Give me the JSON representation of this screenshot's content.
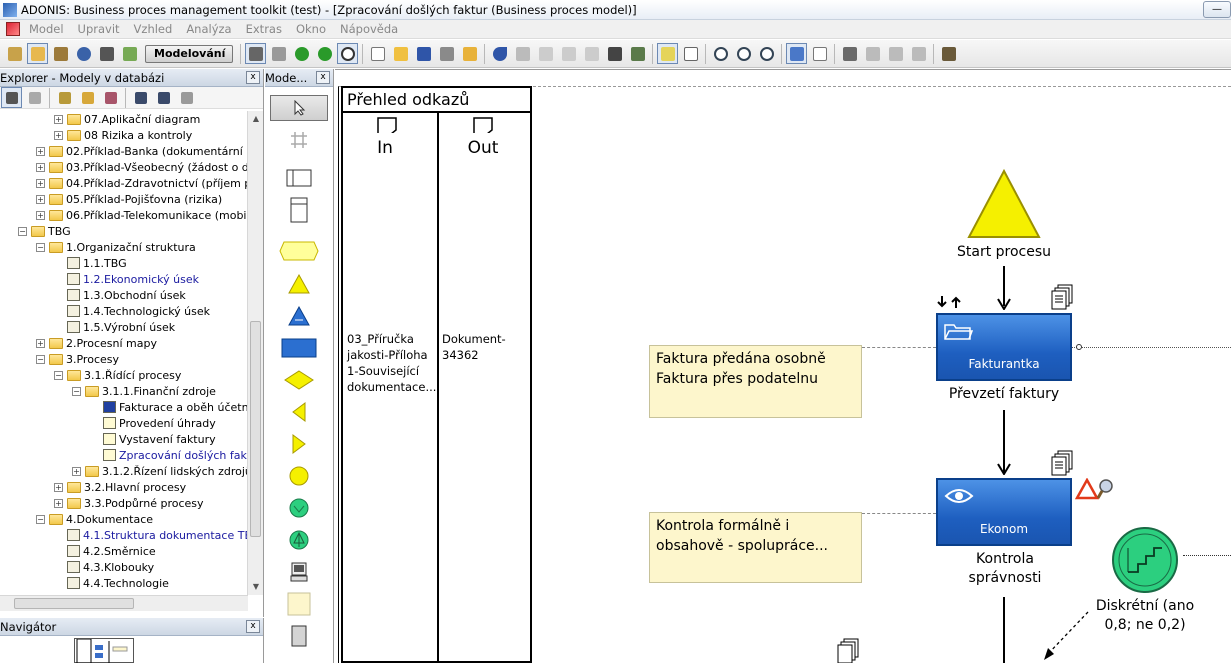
{
  "window": {
    "title": "ADONIS: Business proces management toolkit (test) - [Zpracování došlých faktur (Business proces model)]",
    "minimize_label": "—"
  },
  "menu": {
    "items": [
      "Model",
      "Upravit",
      "Vzhled",
      "Analýza",
      "Extras",
      "Okno",
      "Nápověda"
    ]
  },
  "toolbar": {
    "mode_label": "Modelování"
  },
  "explorer": {
    "title": "Explorer - Modely v databázi",
    "close_label": "x",
    "tree": [
      {
        "label": "07.Aplikační diagram",
        "level": 3,
        "type": "folder",
        "expander": "+"
      },
      {
        "label": "08 Rizika a kontroly",
        "level": 3,
        "type": "folder",
        "expander": "+"
      },
      {
        "label": "02.Příklad-Banka (dokumentární pla",
        "level": 2,
        "type": "folder",
        "expander": "+"
      },
      {
        "label": "03.Příklad-Všeobecný (žádost o dov",
        "level": 2,
        "type": "folder",
        "expander": "+"
      },
      {
        "label": "04.Příklad-Zdravotnictví (příjem pac",
        "level": 2,
        "type": "folder",
        "expander": "+"
      },
      {
        "label": "05.Příklad-Pojišťovna (rizika)",
        "level": 2,
        "type": "folder",
        "expander": "+"
      },
      {
        "label": "06.Příklad-Telekomunikace (mobilní",
        "level": 2,
        "type": "folder",
        "expander": "+"
      },
      {
        "label": "TBG",
        "level": 1,
        "type": "folder",
        "expander": "−"
      },
      {
        "label": "1.Organizační struktura",
        "level": 2,
        "type": "folder",
        "expander": "−"
      },
      {
        "label": "1.1.TBG",
        "level": 3,
        "type": "model"
      },
      {
        "label": "1.2.Ekonomický úsek",
        "level": 3,
        "type": "model",
        "highlight": true
      },
      {
        "label": "1.3.Obchodní úsek",
        "level": 3,
        "type": "model"
      },
      {
        "label": "1.4.Technologický úsek",
        "level": 3,
        "type": "model"
      },
      {
        "label": "1.5.Výrobní úsek",
        "level": 3,
        "type": "model"
      },
      {
        "label": "2.Procesní mapy",
        "level": 2,
        "type": "folder",
        "expander": "+"
      },
      {
        "label": "3.Procesy",
        "level": 2,
        "type": "folder",
        "expander": "−"
      },
      {
        "label": "3.1.Řídící procesy",
        "level": 3,
        "type": "folder",
        "expander": "−"
      },
      {
        "label": "3.1.1.Finanční zdroje",
        "level": 4,
        "type": "folder",
        "expander": "−"
      },
      {
        "label": "Fakturace a oběh účetn",
        "level": 5,
        "type": "model-blue"
      },
      {
        "label": "Provedení úhrady",
        "level": 5,
        "type": "proc"
      },
      {
        "label": "Vystavení faktury",
        "level": 5,
        "type": "proc"
      },
      {
        "label": "Zpracování došlých fakt",
        "level": 5,
        "type": "proc",
        "highlight": true
      },
      {
        "label": "3.1.2.Řízení lidských zdrojů",
        "level": 4,
        "type": "folder",
        "expander": "+"
      },
      {
        "label": "3.2.Hlavní procesy",
        "level": 3,
        "type": "folder",
        "expander": "+"
      },
      {
        "label": "3.3.Podpůrné procesy",
        "level": 3,
        "type": "folder",
        "expander": "+"
      },
      {
        "label": "4.Dokumentace",
        "level": 2,
        "type": "folder",
        "expander": "−"
      },
      {
        "label": "4.1.Struktura dokumentace TBG",
        "level": 3,
        "type": "model",
        "highlight": true
      },
      {
        "label": "4.2.Směrnice",
        "level": 3,
        "type": "model"
      },
      {
        "label": "4.3.Klobouky",
        "level": 3,
        "type": "model"
      },
      {
        "label": "4.4.Technologie",
        "level": 3,
        "type": "model"
      }
    ]
  },
  "navigator": {
    "title": "Navigátor",
    "close_label": "x"
  },
  "palette": {
    "title": "Mode...",
    "close_label": "x"
  },
  "reference_table": {
    "title": "Přehled odkazů",
    "col_in": "In",
    "col_out": "Out",
    "in_text": "03_Příručka jakosti-Příloha 1-Související dokumentace...",
    "out_text": "Dokument-34362"
  },
  "diagram": {
    "start_label": "Start procesu",
    "activity1": {
      "role": "Fakturantka",
      "label": "Převzetí faktury"
    },
    "activity2": {
      "role": "Ekonom",
      "label": "Kontrola správnosti"
    },
    "note1": "Faktura předána osobně Faktura přes podatelnu",
    "note2": "Kontrola formálně i obsahově - spolupráce...",
    "decision_label": "Diskrétní (ano 0,8; ne 0,2)",
    "colors": {
      "activity_fill": "#2b6fd0",
      "start_fill": "#f5f000",
      "decision_fill": "#2ccf7f",
      "note_fill": "#fdf6cc"
    }
  }
}
